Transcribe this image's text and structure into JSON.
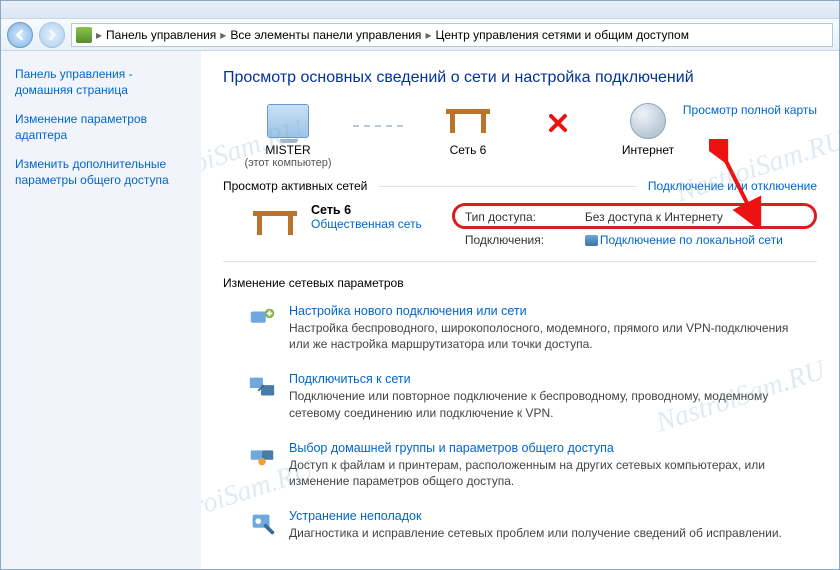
{
  "breadcrumb": {
    "items": [
      "Панель управления",
      "Все элементы панели управления",
      "Центр управления сетями и общим доступом"
    ]
  },
  "sidebar": {
    "links": [
      "Панель управления - домашняя страница",
      "Изменение параметров адаптера",
      "Изменить дополнительные параметры общего доступа"
    ]
  },
  "main": {
    "heading": "Просмотр основных сведений о сети и настройка подключений",
    "full_map_link": "Просмотр полной карты",
    "map": {
      "computer": {
        "name": "MISTER",
        "sub": "(этот компьютер)"
      },
      "network": {
        "name": "Сеть 6"
      },
      "internet": {
        "name": "Интернет"
      }
    },
    "active_networks": {
      "label": "Просмотр активных сетей",
      "connect_link": "Подключение или отключение",
      "network_name": "Сеть 6",
      "network_type": "Общественная сеть",
      "access_label": "Тип доступа:",
      "access_value": "Без доступа к Интернету",
      "connections_label": "Подключения:",
      "connections_value": "Подключение по локальной сети"
    },
    "settings_heading": "Изменение сетевых параметров",
    "options": [
      {
        "title": "Настройка нового подключения или сети",
        "desc": "Настройка беспроводного, широкополосного, модемного, прямого или VPN-подключения или же настройка маршрутизатора или точки доступа."
      },
      {
        "title": "Подключиться к сети",
        "desc": "Подключение или повторное подключение к беспроводному, проводному, модемному сетевому соединению или подключение к VPN."
      },
      {
        "title": "Выбор домашней группы и параметров общего доступа",
        "desc": "Доступ к файлам и принтерам, расположенным на других сетевых компьютерах, или изменение параметров общего доступа."
      },
      {
        "title": "Устранение неполадок",
        "desc": "Диагностика и исправление сетевых проблем или получение сведений об исправлении."
      }
    ]
  },
  "watermark": "NastroiSam.RU"
}
